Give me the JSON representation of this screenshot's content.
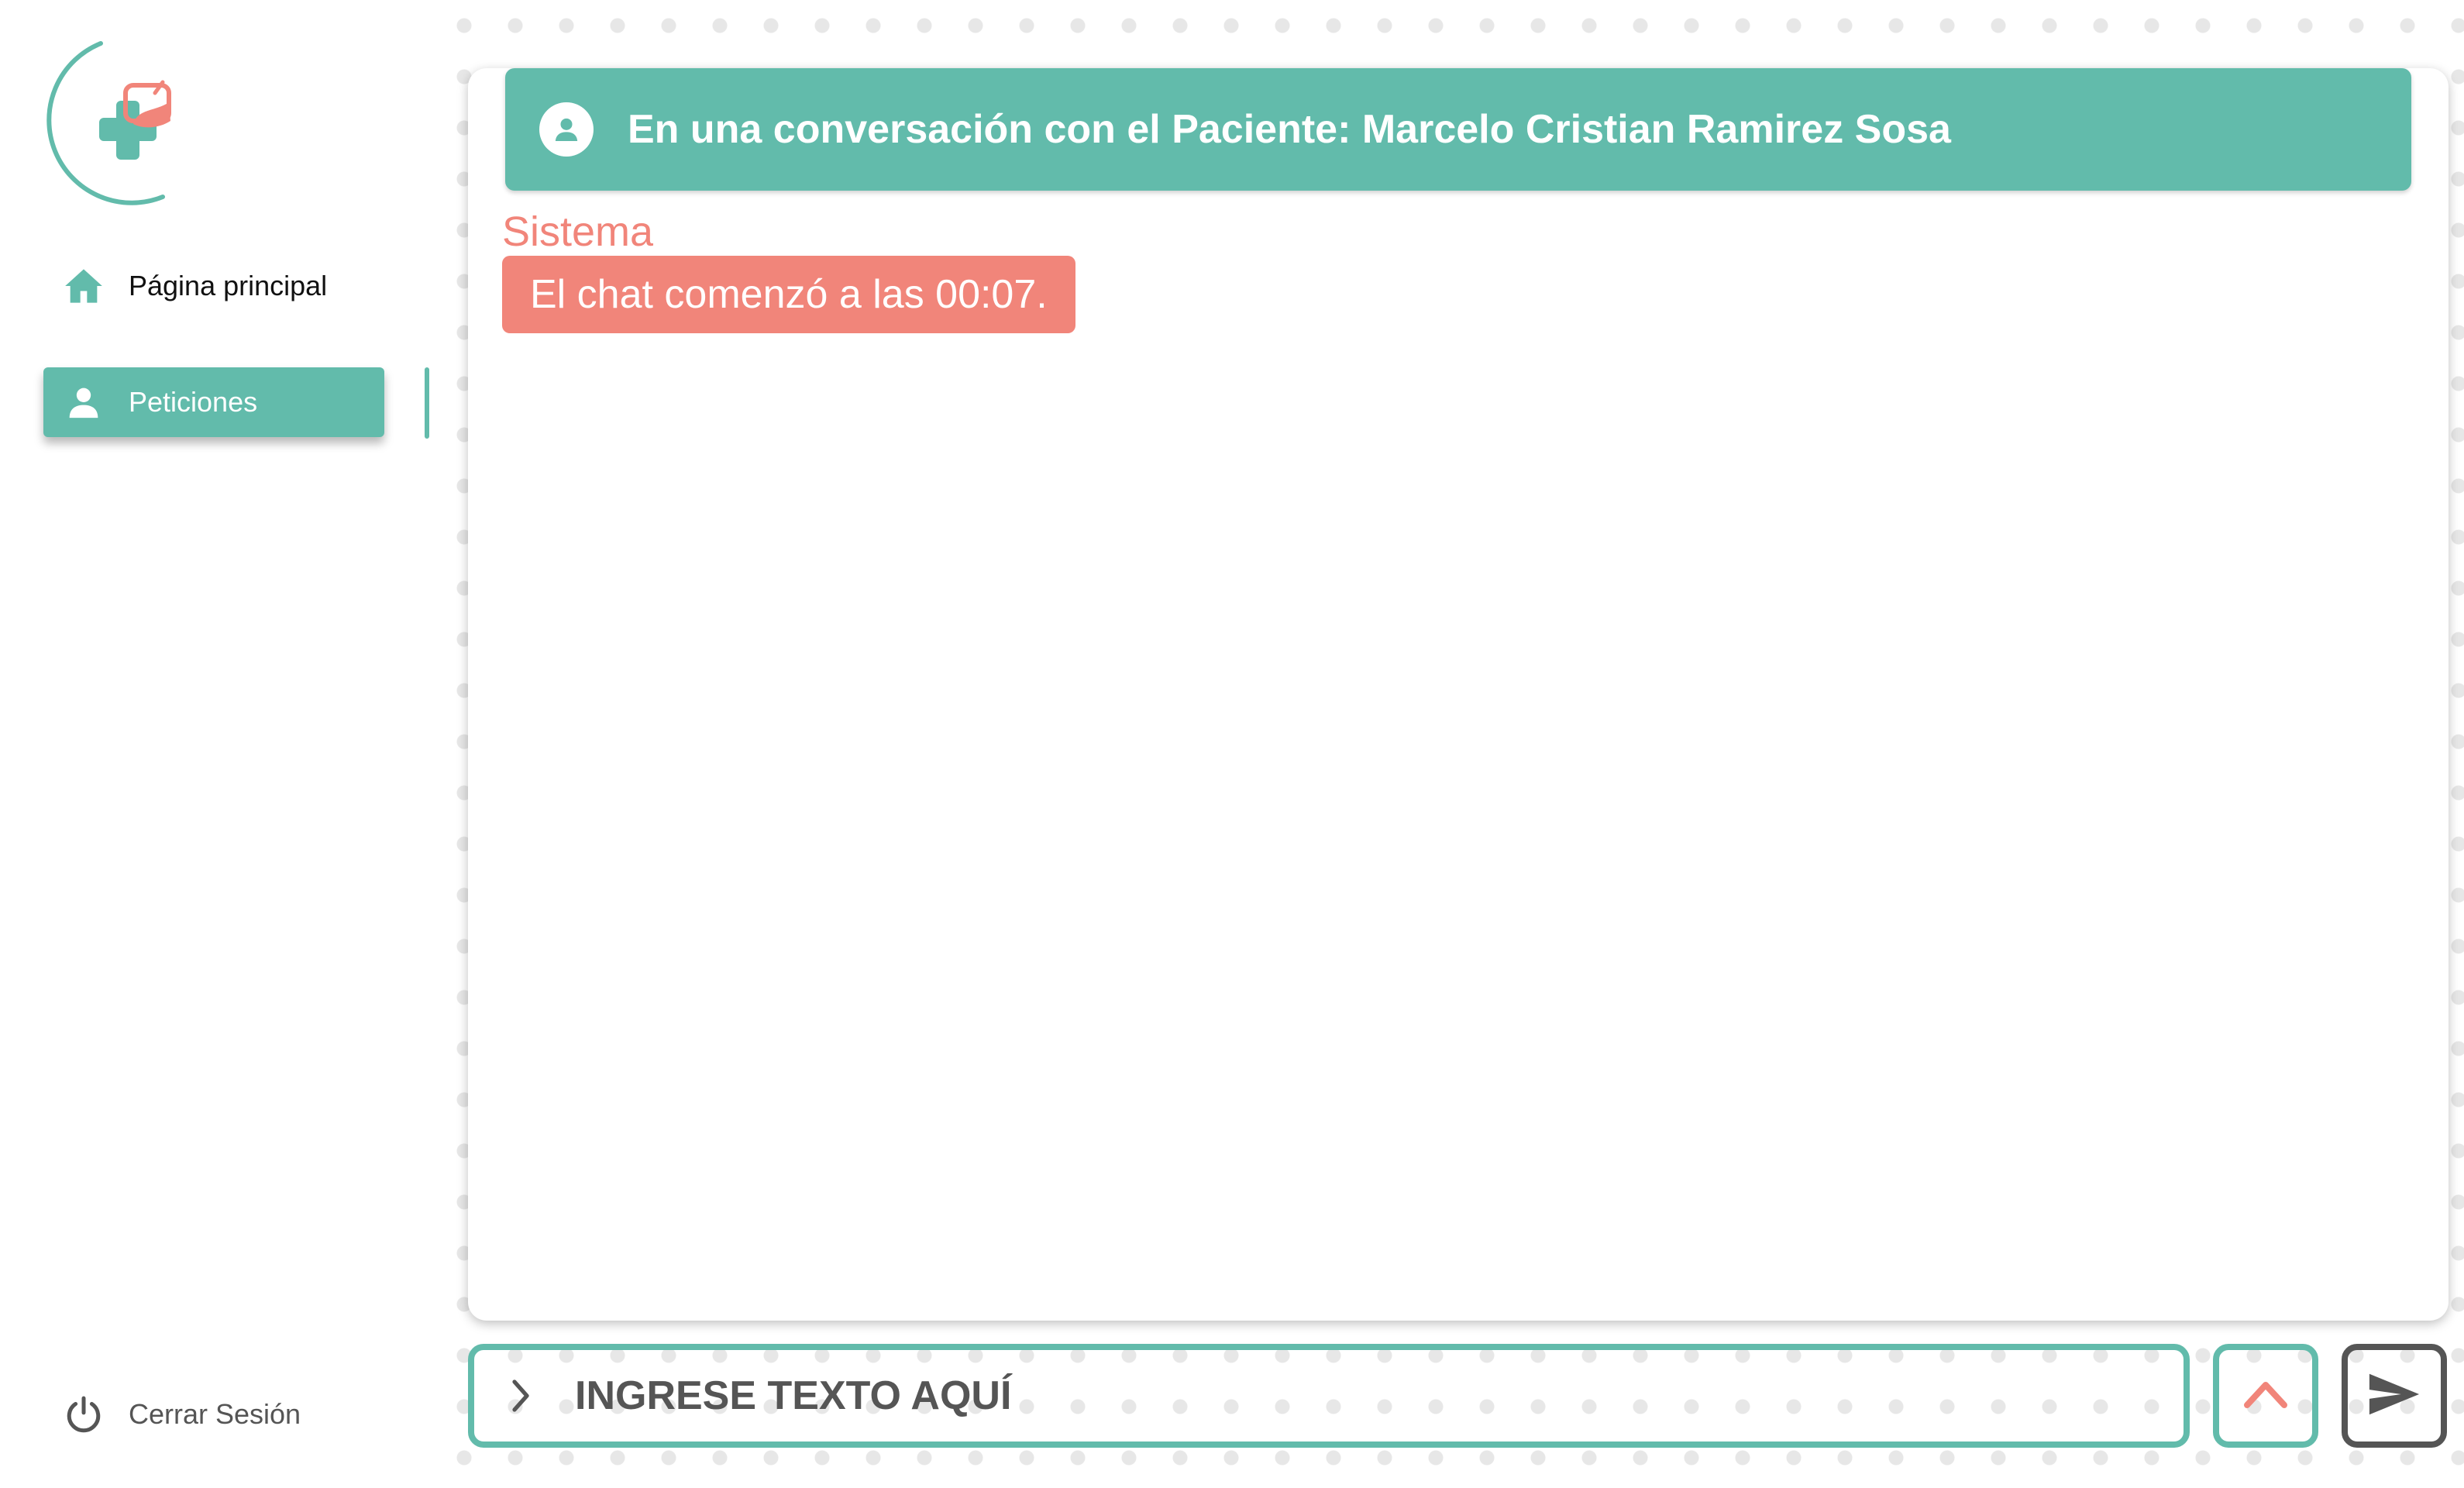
{
  "sidebar": {
    "logo_icon": "clinic-cross-heart-logo",
    "items": [
      {
        "label": "Página principal",
        "icon": "home-icon"
      },
      {
        "label": "Peticiones",
        "icon": "person-icon",
        "active": true
      }
    ],
    "logout_label": "Cerrar Sesión",
    "logout_icon": "power-icon"
  },
  "chat": {
    "header_title": "En una conversación con el Paciente: Marcelo Cristian Ramirez Sosa",
    "header_icon": "account-circle-icon",
    "messages": [
      {
        "sender": "Sistema",
        "text": "El chat comenzó a las 00:07."
      }
    ]
  },
  "input": {
    "placeholder": "INGRESE TEXTO AQUÍ"
  },
  "colors": {
    "accent": "#62bbab",
    "system_message": "#f1857a",
    "text_dark": "#555555"
  }
}
